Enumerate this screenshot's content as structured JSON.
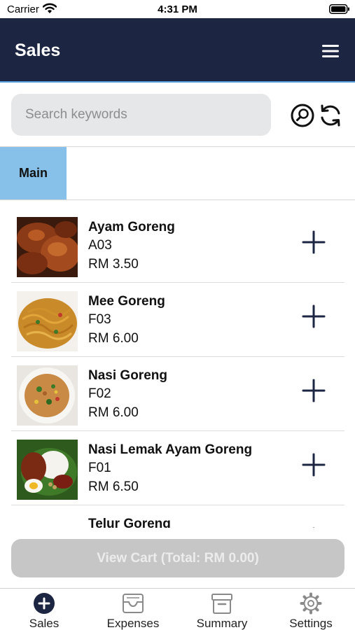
{
  "status_bar": {
    "carrier": "Carrier",
    "time": "4:31 PM"
  },
  "header": {
    "title": "Sales"
  },
  "search": {
    "placeholder": "Search keywords",
    "value": ""
  },
  "categories": [
    {
      "label": "Main",
      "selected": true
    }
  ],
  "products": [
    {
      "name": "Ayam Goreng",
      "code": "A03",
      "price": "RM 3.50",
      "image": "fried-chicken-photo"
    },
    {
      "name": "Mee Goreng",
      "code": "F03",
      "price": "RM 6.00",
      "image": "fried-noodles-photo"
    },
    {
      "name": "Nasi Goreng",
      "code": "F02",
      "price": "RM 6.00",
      "image": "fried-rice-photo"
    },
    {
      "name": "Nasi Lemak Ayam Goreng",
      "code": "F01",
      "price": "RM 6.50",
      "image": "nasi-lemak-photo"
    },
    {
      "name": "Telur Goreng",
      "code": "",
      "price": "",
      "image": "fried-egg-photo"
    }
  ],
  "cart": {
    "label": "View Cart (Total:  RM 0.00)"
  },
  "tabs": [
    {
      "label": "Sales",
      "icon": "plus-circle-icon",
      "active": true
    },
    {
      "label": "Expenses",
      "icon": "inbox-tray-icon",
      "active": false
    },
    {
      "label": "Summary",
      "icon": "archive-box-icon",
      "active": false
    },
    {
      "label": "Settings",
      "icon": "gear-icon",
      "active": false
    }
  ],
  "colors": {
    "header_bg": "#1c2541",
    "category_selected": "#87c0e8",
    "cart_button_disabled": "#c6c6c6",
    "tab_active": "#1c2541",
    "tab_inactive": "#8a8a8a"
  }
}
